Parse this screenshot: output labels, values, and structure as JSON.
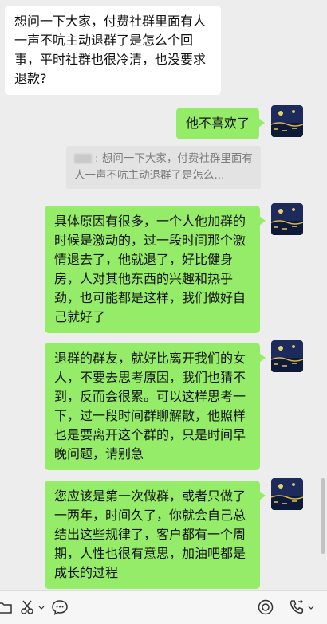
{
  "messages": [
    {
      "side": "in",
      "text": "想问一下大家，付费社群里面有人一声不吭主动退群了是怎么个回事，平时社群也很冷清，也没要求退款?"
    },
    {
      "side": "out",
      "text": "他不喜欢了"
    },
    {
      "side": "quote",
      "text": ": 想问一下大家，付费社群里面有人一声不吭主动退群了是怎么..."
    },
    {
      "side": "out",
      "text": "具体原因有很多，一个人他加群的时候是激动的，过一段时间那个激情退去了，他就退了，好比健身房，人对其他东西的兴趣和热乎劲，也可能都是这样，我们做好自己就好了"
    },
    {
      "side": "out",
      "text": "退群的群友，就好比离开我们的女人，不要去思考原因，我们也猜不到，反而会很累。可以这样思考一下，过一段时间群聊解散，他照样也是要离开这个群的，只是时间早晚问题，请别急"
    },
    {
      "side": "out",
      "text": "您应该是第一次做群，或者只做了一两年，时间久了，你就会自己总结出这些规律了，客户都有一个周期，人性也很有意思，加油吧都是成长的过程"
    }
  ],
  "toolbar": {
    "left_icons": [
      "folder-icon",
      "scissors-icon",
      "chat-bubble-icon"
    ],
    "right_icons": [
      "live-icon",
      "phone-icon"
    ]
  },
  "colors": {
    "outgoing": "#95ec69",
    "incoming": "#ffffff",
    "background": "#ededed"
  }
}
